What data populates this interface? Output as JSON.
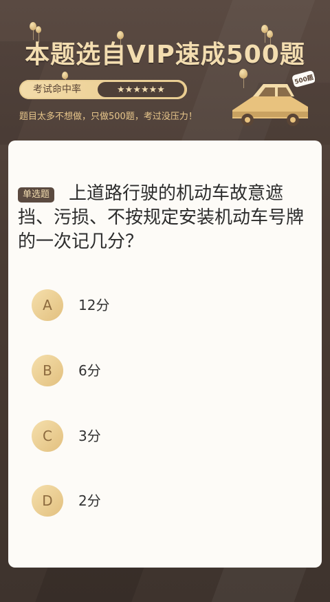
{
  "header": {
    "title": "本题选自VIP速成500题",
    "rate_label": "考试命中率",
    "stars": "★★★★★★",
    "subtitle": "题目太多不想做，只做500题，考过没压力！",
    "badge": "500题"
  },
  "question": {
    "type_tag": "单选题",
    "text": "上道路行驶的机动车故意遮挡、污损、不按规定安装机动车号牌的一次记几分？"
  },
  "options": [
    {
      "letter": "A",
      "text": "12分"
    },
    {
      "letter": "B",
      "text": "6分"
    },
    {
      "letter": "C",
      "text": "3分"
    },
    {
      "letter": "D",
      "text": "2分"
    }
  ],
  "colors": {
    "accent_gold": "#f3ddb0",
    "background": "#4a3c35",
    "card": "#fdfbf7"
  }
}
